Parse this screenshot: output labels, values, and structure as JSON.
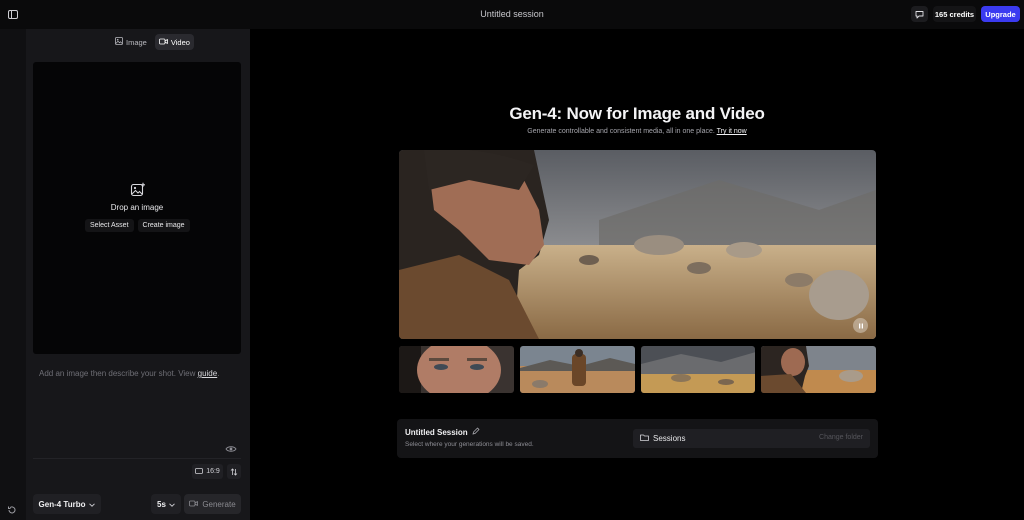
{
  "topbar": {
    "session_title": "Untitled session",
    "credits": "165 credits",
    "upgrade": "Upgrade"
  },
  "panel": {
    "tabs": [
      {
        "label": "Image",
        "icon": "image-icon",
        "active": false
      },
      {
        "label": "Video",
        "icon": "video-icon",
        "active": true
      }
    ],
    "dropzone": {
      "title": "Drop an image",
      "select_asset": "Select Asset",
      "create_image": "Create image"
    },
    "prompt": {
      "text": "Add an image then describe your shot. View",
      "link": "guide",
      "end": "."
    },
    "ratio": "16:9",
    "model": "Gen-4 Turbo",
    "duration": "5s",
    "generate": "Generate"
  },
  "main": {
    "title": "Gen-4: Now for Image and Video",
    "subtitle": "Generate controllable and consistent media, all in one place.",
    "try_link": "Try it now"
  },
  "session_card": {
    "title": "Untitled Session",
    "subtitle": "Select where your generations will be saved.",
    "sessions_label": "Sessions",
    "change_label": "Change folder"
  },
  "colors": {
    "accent": "#3b3bf0",
    "background": "#000000",
    "panel": "#17171a"
  }
}
